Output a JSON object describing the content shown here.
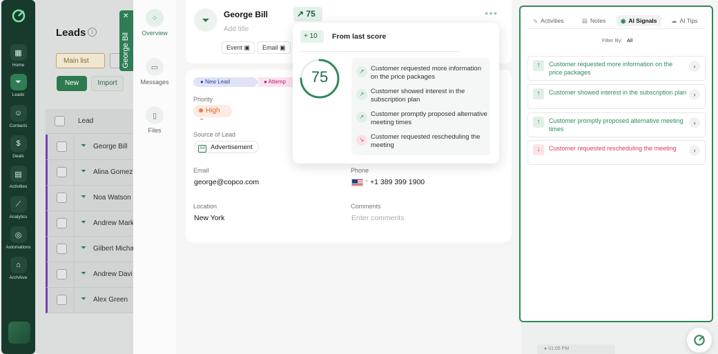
{
  "rail": {
    "items": [
      {
        "label": "Home",
        "icon": "grid-icon"
      },
      {
        "label": "Leads",
        "icon": "funnel-icon"
      },
      {
        "label": "Contacts",
        "icon": "contact-icon"
      },
      {
        "label": "Deals",
        "icon": "dollar-icon"
      },
      {
        "label": "Activities",
        "icon": "calendar-icon"
      },
      {
        "label": "Analytics",
        "icon": "chart-icon"
      },
      {
        "label": "Automations",
        "icon": "target-icon"
      },
      {
        "label": "ArchAive",
        "icon": "archive-icon"
      }
    ],
    "active": "Leads"
  },
  "leads": {
    "title": "Leads",
    "list_tab": "Main list",
    "new_label": "New",
    "import_label": "Import",
    "column_lead": "Lead",
    "rows": [
      "George Bill",
      "Alina Gomez",
      "Noa Watson",
      "Andrew Mark",
      "Gilbert Micha",
      "Andrew Davi",
      "Alex Green"
    ]
  },
  "sidetab": {
    "name": "George Bil"
  },
  "vnav": {
    "overview": "Overview",
    "messages": "Messages",
    "files": "Files"
  },
  "lead": {
    "name": "George Bill",
    "add_title": "Add title",
    "chip_event": "Event",
    "chip_email": "Email",
    "score": "75"
  },
  "stages": {
    "s1": "New Lead",
    "s2": "Attemp"
  },
  "fields": {
    "priority_label": "Priority",
    "priority_value": "High",
    "source_label": "Source of Lead",
    "source_value": "Advertisement",
    "email_label": "Email",
    "email_value": "george@copco.com",
    "phone_label": "Phone",
    "phone_value": "+1 389 399 1900",
    "location_label": "Location",
    "location_value": "New York",
    "comments_label": "Comments",
    "comments_placeholder": "Enter comments"
  },
  "popover": {
    "delta": "+ 10",
    "delta_text": "From last score",
    "score": "75",
    "score_fraction": 0.75,
    "signals": [
      {
        "text": "Customer requested more information on the price packages",
        "positive": true
      },
      {
        "text": "Customer showed interest in the subscription plan",
        "positive": true
      },
      {
        "text": "Customer promptly proposed alternative meeting times",
        "positive": true
      },
      {
        "text": "Customer requested rescheduling the meeting",
        "positive": false
      }
    ]
  },
  "rpanel": {
    "tabs": [
      "Activities",
      "Notes",
      "AI Signals",
      "AI Tips"
    ],
    "active_tab": "AI Signals",
    "filter_label": "Filter By:",
    "filter_value": "All",
    "signals": [
      {
        "text": "Customer requested more information on the price packages",
        "positive": true
      },
      {
        "text": "Customer showed interest in the subscription plan",
        "positive": true
      },
      {
        "text": "Customer promptly proposed alternative meeting times",
        "positive": true
      },
      {
        "text": "Customer requested rescheduling the meeting",
        "positive": false
      }
    ],
    "mini_time": "01:05 PM"
  },
  "colors": {
    "brand": "#2f7d54",
    "rail": "#173a2d",
    "negative": "#d3404e",
    "stage_new": "#3342a6",
    "stage_attempt": "#b02070"
  }
}
